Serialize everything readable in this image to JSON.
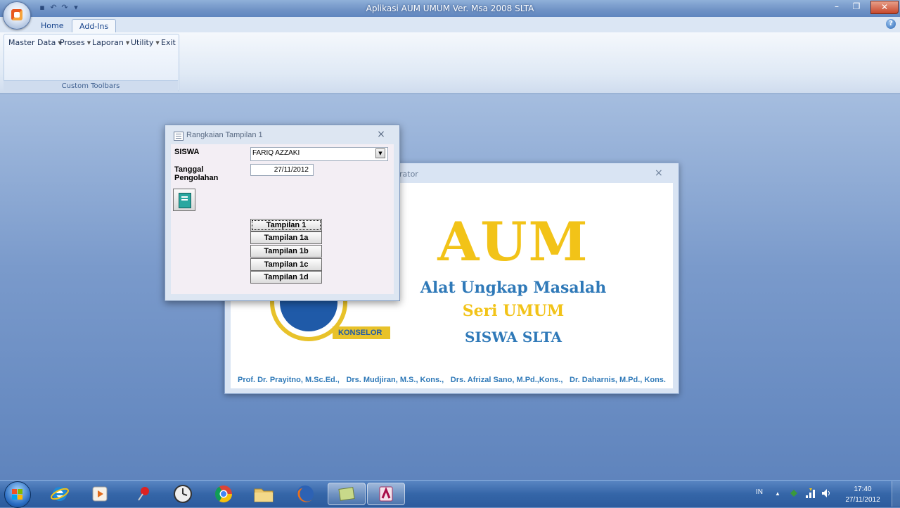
{
  "window": {
    "title": "Aplikasi AUM UMUM Ver. Msa 2008  SLTA",
    "minimize": "–",
    "restore": "❐",
    "close": "✕"
  },
  "quick_access": {
    "save": "▪",
    "undo": "↶",
    "redo": "↷",
    "more": "▾"
  },
  "ribbon": {
    "tabs": [
      "Home",
      "Add-Ins"
    ],
    "active_tab": "Add-Ins",
    "help": "?",
    "menu": [
      "Master Data",
      "Proses",
      "Laporan",
      "Utility",
      "Exit"
    ],
    "group_label": "Custom Toolbars"
  },
  "splash": {
    "title_fragment": "rator",
    "close": "×",
    "heading": "AUM",
    "line1": "Alat Ungkap Masalah",
    "line2": "Seri UMUM",
    "line3": "SISWA SLTA",
    "logo_text": "KONSELOR",
    "authors": [
      "Prof. Dr. Prayitno, M.Sc.Ed.,",
      "Drs. Mudjiran, M.S., Kons.,",
      "Drs. Afrizal Sano, M.Pd.,Kons.,",
      "Dr. Daharnis, M.Pd., Kons."
    ],
    "colors": {
      "gold": "#f2c318",
      "blue": "#2f79b8"
    }
  },
  "dialog": {
    "title": "Rangkaian Tampilan 1",
    "close": "×",
    "siswa_label": "SISWA",
    "siswa_value": "FARIQ AZZAKI",
    "tanggal_label_1": "Tanggal",
    "tanggal_label_2": "Pengolahan",
    "tanggal_value": "27/11/2012",
    "buttons": [
      "Tampilan 1",
      "Tampilan 1a",
      "Tampilan 1b",
      "Tampilan 1c",
      "Tampilan 1d"
    ]
  },
  "taskbar": {
    "icons": [
      "internet-explorer",
      "media-player",
      "pin-app",
      "clock-app",
      "chrome",
      "file-explorer",
      "firefox",
      "notes-app",
      "access"
    ],
    "lang": "IN",
    "tray_arrow": "▲",
    "time": "17:40",
    "date": "27/11/2012"
  }
}
